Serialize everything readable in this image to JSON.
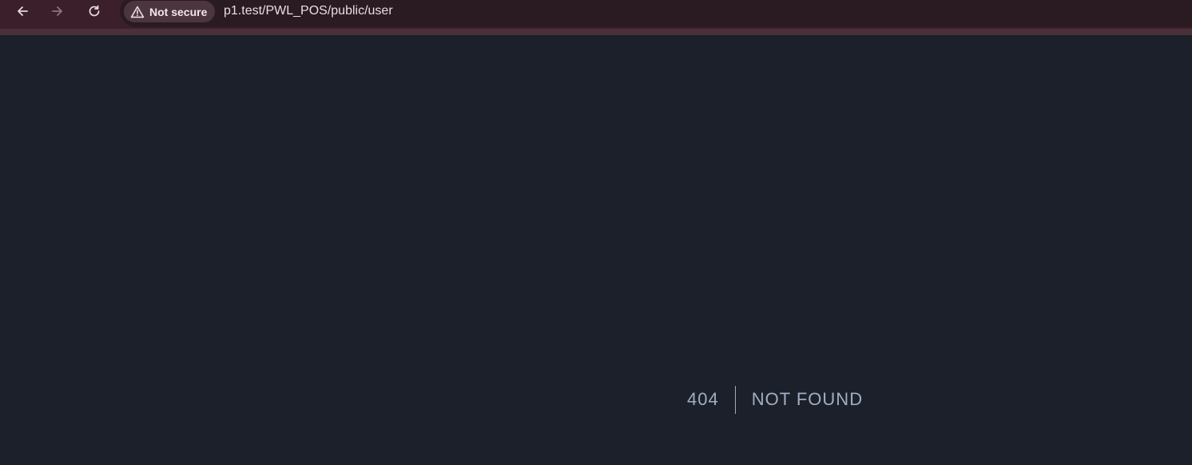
{
  "browser": {
    "back_icon": "arrow-left-icon",
    "forward_icon": "arrow-right-icon",
    "reload_icon": "reload-icon",
    "security_icon": "warning-triangle-icon",
    "security_label": "Not secure",
    "url": "p1.test/PWL_POS/public/user"
  },
  "page": {
    "error_code": "404",
    "error_message": "NOT FOUND"
  },
  "colors": {
    "toolbar_bg": "#3b1f2b",
    "page_bg": "#1b202b",
    "error_text": "#a0aec0"
  }
}
